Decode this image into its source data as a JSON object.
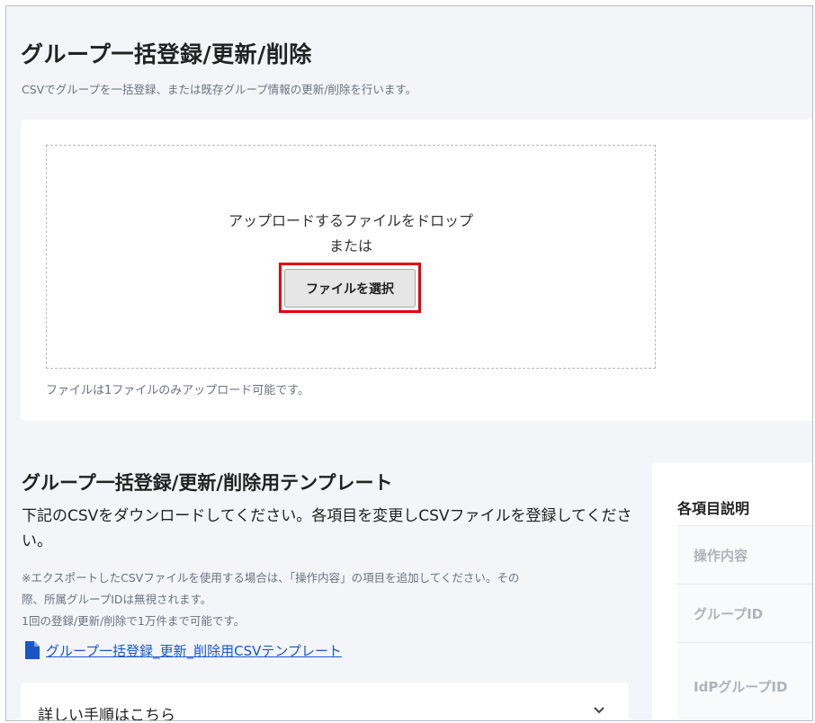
{
  "page": {
    "title": "グループ一括登録/更新/削除",
    "subtitle": "CSVでグループを一括登録、または既存グループ情報の更新/削除を行います。"
  },
  "upload": {
    "drop_text": "アップロードするファイルをドロップ",
    "or_text": "または",
    "select_button": "ファイルを選択",
    "note": "ファイルは1ファイルのみアップロード可能です。"
  },
  "template": {
    "heading": "グループ一括登録/更新/削除用テンプレート",
    "description": "下記のCSVをダウンロードしてください。各項目を変更しCSVファイルを登録してください。",
    "notes": [
      "※エクスポートしたCSVファイルを使用する場合は、「操作内容」の項目を追加してください。その",
      "際、所属グループIDは無視されます。",
      "1回の登録/更新/削除で1万件まで可能です。"
    ],
    "link_label": "グループ一括登録_更新_削除用CSVテンプレート",
    "link_icon": "document-icon"
  },
  "accordion": {
    "label": "詳しい手順はこちら",
    "icon": "chevron-down-icon"
  },
  "side_panel": {
    "title": "各項目説明",
    "items": [
      "操作内容",
      "グループID",
      "IdPグループID"
    ]
  },
  "colors": {
    "highlight": "#e3000f",
    "link": "#1a56c8",
    "background": "#f3f5f9"
  }
}
